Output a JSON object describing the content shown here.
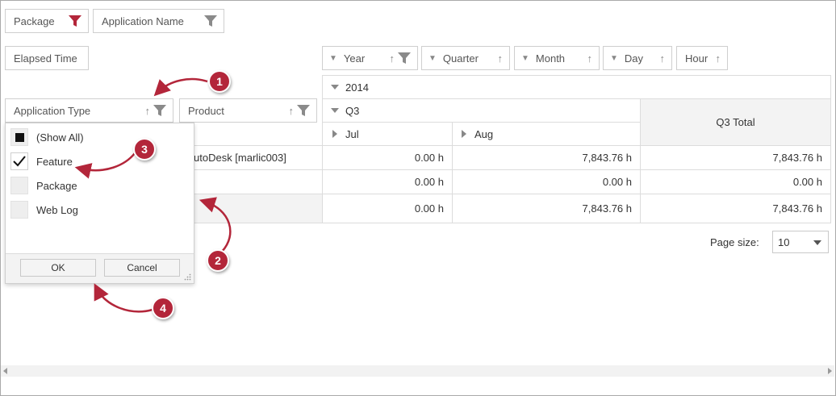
{
  "filter_area": {
    "fields": [
      {
        "label": "Package",
        "filter_active": true
      },
      {
        "label": "Application Name",
        "filter_active": false
      }
    ]
  },
  "data_area": {
    "fields": [
      {
        "label": "Elapsed Time"
      }
    ]
  },
  "column_area": {
    "fields": [
      {
        "label": "Year",
        "sort": "↑",
        "filter": true
      },
      {
        "label": "Quarter",
        "sort": "↑",
        "filter": false
      },
      {
        "label": "Month",
        "sort": "↑",
        "filter": false
      },
      {
        "label": "Day",
        "sort": "↑",
        "filter": false
      },
      {
        "label": "Hour",
        "sort": "↑",
        "filter": false
      }
    ]
  },
  "row_area": {
    "fields": [
      {
        "label": "Application Type",
        "sort": "↑"
      },
      {
        "label": "Product",
        "sort": "↑"
      }
    ]
  },
  "grid": {
    "year": "2014",
    "quarter": "Q3",
    "months": [
      "Jul",
      "Aug"
    ],
    "total_header": "Q3 Total",
    "rows": [
      {
        "label": "utoDesk [marlic003]",
        "values": [
          "0.00 h",
          "7,843.76 h",
          "7,843.76 h"
        ]
      },
      {
        "label": "",
        "values": [
          "0.00 h",
          "0.00 h",
          "0.00 h"
        ]
      },
      {
        "label": "",
        "values": [
          "0.00 h",
          "7,843.76 h",
          "7,843.76 h"
        ]
      }
    ]
  },
  "pager": {
    "label": "Page size:",
    "value": "10"
  },
  "popup": {
    "options": [
      {
        "label": "(Show All)",
        "state": "indeterminate"
      },
      {
        "label": "Feature",
        "state": "checked"
      },
      {
        "label": "Package",
        "state": "unchecked"
      },
      {
        "label": "Web Log",
        "state": "unchecked"
      }
    ],
    "ok_label": "OK",
    "cancel_label": "Cancel"
  },
  "callouts": [
    "1",
    "2",
    "3",
    "4"
  ],
  "colors": {
    "accent": "#b3263a",
    "border": "#cfcfcf",
    "icon": "#8a8a8a"
  }
}
